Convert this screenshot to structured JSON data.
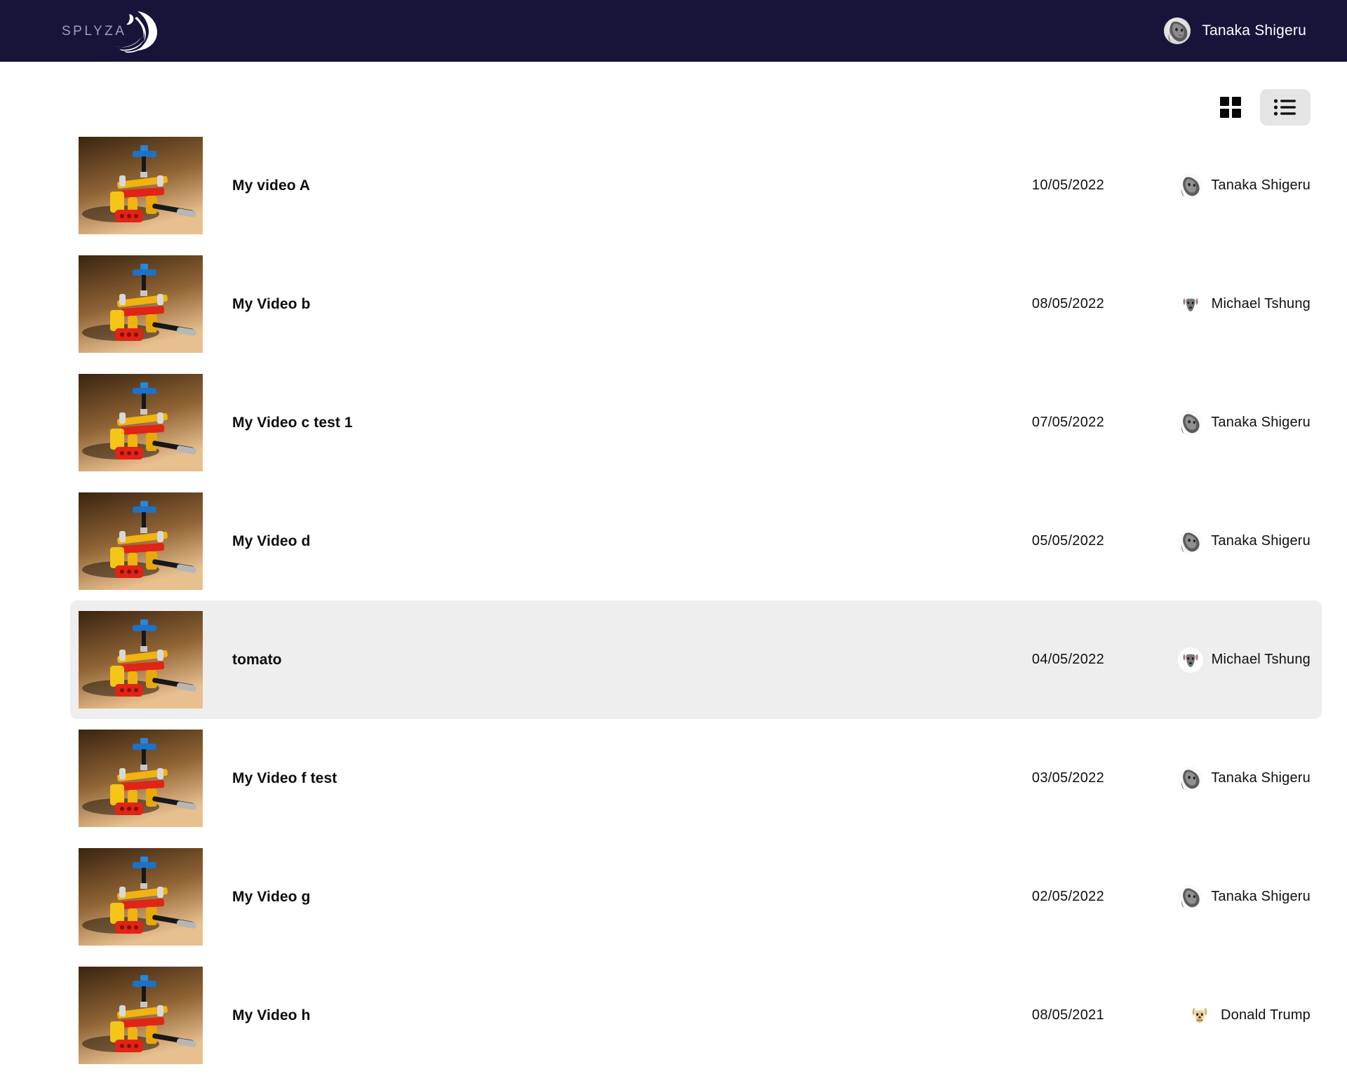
{
  "brand": {
    "name": "SPLYZA",
    "logo_icon": "splyza-wing-logo",
    "wordmark": "SPLYZA"
  },
  "header": {
    "user": {
      "name": "Tanaka Shigeru",
      "avatar_icon": "dog-photo-avatar"
    }
  },
  "toolbar": {
    "grid_view_label": "Grid view",
    "grid_view_icon": "grid-view-icon",
    "list_view_label": "List view",
    "list_view_icon": "list-view-icon",
    "active_view": "list"
  },
  "colors": {
    "header_background": "#17143a",
    "page_background": "#ffffff",
    "selected_row_background": "#eeeeee",
    "active_toggle_background": "#e5e5e5",
    "text_primary": "#101010"
  },
  "videos": [
    {
      "title": "My video A",
      "date": "10/05/2022",
      "owner": "Tanaka Shigeru",
      "owner_avatar": "dog-photo-avatar",
      "selected": false
    },
    {
      "title": "My Video b",
      "date": "08/05/2022",
      "owner": "Michael Tshung",
      "owner_avatar": "gray-dog-face-avatar",
      "selected": false
    },
    {
      "title": "My Video c test 1",
      "date": "07/05/2022",
      "owner": "Tanaka Shigeru",
      "owner_avatar": "dog-photo-avatar",
      "selected": false
    },
    {
      "title": "My Video d",
      "date": "05/05/2022",
      "owner": "Tanaka Shigeru",
      "owner_avatar": "dog-photo-avatar",
      "selected": false
    },
    {
      "title": "tomato",
      "date": "04/05/2022",
      "owner": "Michael Tshung",
      "owner_avatar": "gray-dog-face-avatar",
      "selected": true
    },
    {
      "title": "My Video f test",
      "date": "03/05/2022",
      "owner": "Tanaka Shigeru",
      "owner_avatar": "dog-photo-avatar",
      "selected": false
    },
    {
      "title": "My Video g",
      "date": "02/05/2022",
      "owner": "Tanaka Shigeru",
      "owner_avatar": "dog-photo-avatar",
      "selected": false
    },
    {
      "title": "My Video h",
      "date": "08/05/2021",
      "owner": "Donald Trump",
      "owner_avatar": "terrier-dog-face-avatar",
      "selected": false
    }
  ]
}
